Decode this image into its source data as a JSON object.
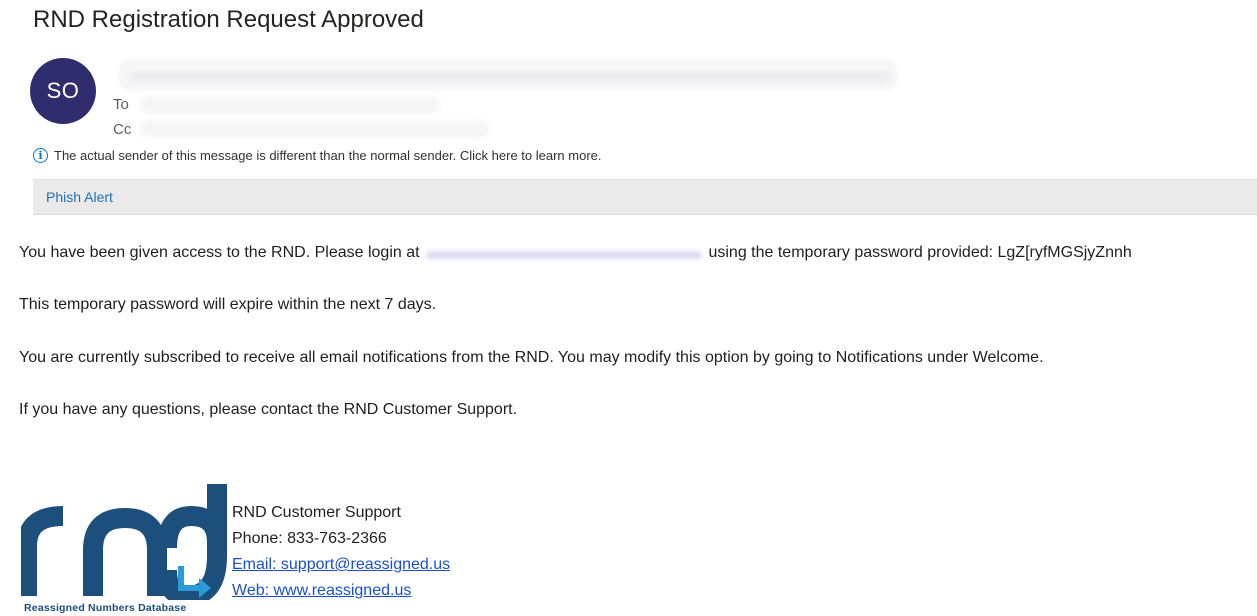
{
  "email": {
    "subject": "RND Registration Request Approved",
    "avatar_initials": "SO",
    "to_label": "To",
    "cc_label": "Cc",
    "sender_notice": "The actual sender of this message is different than the normal sender. Click here to learn more.",
    "phish_alert_label": "Phish Alert"
  },
  "body": {
    "line1_prefix": "You have been given access to the RND. Please login at",
    "line1_suffix": "using the temporary password provided: LgZ[ryfMGSjyZnnh",
    "line2": "This temporary password will expire within the next 7 days.",
    "line3": "You are currently subscribed to receive all email notifications from the RND. You may modify this option by going to Notifications under Welcome.",
    "line4": "If you have any questions, please contact the RND Customer Support."
  },
  "signature": {
    "logo_caption": "Reassigned Numbers Database",
    "name": "RND Customer Support",
    "phone": "Phone: 833-763-2366",
    "email_link": "Email: support@reassigned.us",
    "web_link": "Web: www.reassigned.us"
  },
  "colors": {
    "avatar_bg": "#2f2d6e",
    "logo_blue": "#1d4f7c",
    "link_blue": "#1a4fd1"
  }
}
